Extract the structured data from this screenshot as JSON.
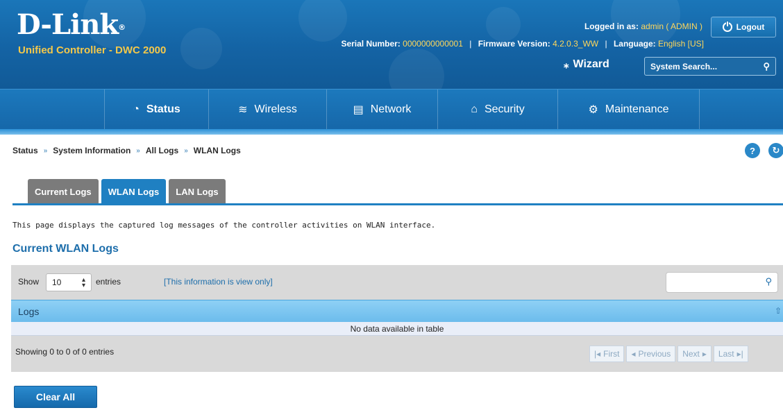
{
  "header": {
    "logo_text": "D-Link",
    "logo_mark": "®",
    "product": "Unified Controller - DWC 2000",
    "logged_in_label": "Logged in as:",
    "logged_in_user": "admin ( ADMIN )",
    "logout_label": "Logout",
    "serial_label": "Serial Number:",
    "serial_value": "0000000000001",
    "firmware_label": "Firmware Version:",
    "firmware_value": "4.2.0.3_WW",
    "language_label": "Language:",
    "language_value": "English [US]",
    "wizard_label": "Wizard",
    "search_placeholder": "System Search..."
  },
  "nav": {
    "items": [
      {
        "label": "Status",
        "icon": "dashboard-gauge-icon",
        "active": true
      },
      {
        "label": "Wireless",
        "icon": "wifi-icon",
        "active": false
      },
      {
        "label": "Network",
        "icon": "monitor-icon",
        "active": false
      },
      {
        "label": "Security",
        "icon": "lock-icon",
        "active": false
      },
      {
        "label": "Maintenance",
        "icon": "gears-icon",
        "active": false
      }
    ]
  },
  "breadcrumb": [
    "Status",
    "System Information",
    "All Logs",
    "WLAN Logs"
  ],
  "tabs": [
    {
      "label": "Current Logs",
      "active": false
    },
    {
      "label": "WLAN Logs",
      "active": true
    },
    {
      "label": "LAN Logs",
      "active": false
    }
  ],
  "description": "This page displays the captured log messages of the controller activities on WLAN interface.",
  "section_title": "Current WLAN Logs",
  "table": {
    "show_label": "Show",
    "page_size": "10",
    "entries_label": "entries",
    "view_only_note": "[This information is view only]",
    "column_header": "Logs",
    "empty_message": "No data available in table",
    "info": "Showing 0 to 0 of 0 entries",
    "pager": {
      "first": "First",
      "previous": "Previous",
      "next": "Next",
      "last": "Last"
    }
  },
  "clear_all_label": "Clear All",
  "colors": {
    "brand_blue": "#1a76b9",
    "accent_yellow": "#ffd75a",
    "tab_active": "#1f80c2"
  }
}
